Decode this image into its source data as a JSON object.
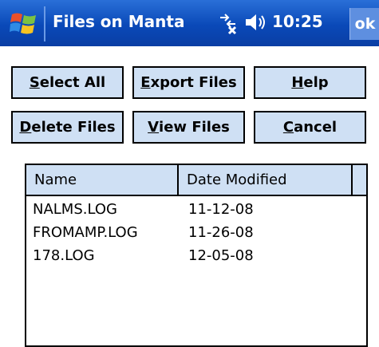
{
  "titlebar": {
    "title": "Files on Manta",
    "time": "10:25",
    "ok_label": "ok",
    "icons": [
      "windows-start-icon",
      "connectivity-icon",
      "speaker-icon"
    ]
  },
  "buttons": {
    "select_all": {
      "mnemonic": "S",
      "rest": "elect All"
    },
    "export_files": {
      "mnemonic": "E",
      "rest": "xport Files"
    },
    "help": {
      "mnemonic": "H",
      "rest": "elp"
    },
    "delete_files": {
      "mnemonic": "D",
      "rest": "elete Files"
    },
    "view_files": {
      "mnemonic": "V",
      "rest": "iew Files"
    },
    "cancel": {
      "mnemonic": "C",
      "rest": "ancel"
    }
  },
  "list": {
    "columns": [
      "Name",
      "Date Modified"
    ],
    "rows": [
      {
        "name": "NALMS.LOG",
        "date": "11-12-08"
      },
      {
        "name": "FROMAMP.LOG",
        "date": "11-26-08"
      },
      {
        "name": "178.LOG",
        "date": "12-05-08"
      }
    ]
  },
  "colors": {
    "titlebar": "#0a49b8",
    "button_face": "#cfe0f4"
  }
}
